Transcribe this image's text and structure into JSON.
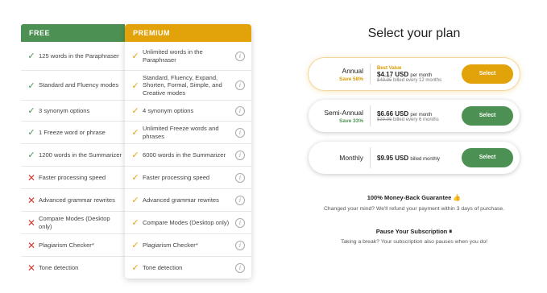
{
  "table": {
    "free_header": "FREE",
    "premium_header": "PREMIUM",
    "rows": [
      {
        "free": "125 words in the Paraphraser",
        "free_ok": true,
        "premium": "Unlimited words in the Paraphraser"
      },
      {
        "free": "Standard and Fluency modes",
        "free_ok": true,
        "premium": "Standard, Fluency, Expand, Shorten, Formal, Simple, and Creative modes"
      },
      {
        "free": "3 synonym options",
        "free_ok": true,
        "premium": "4 synonym options"
      },
      {
        "free": "1 Freeze word or phrase",
        "free_ok": true,
        "premium": "Unlimited Freeze words and phrases"
      },
      {
        "free": "1200 words in the Summarizer",
        "free_ok": true,
        "premium": "6000 words in the Summarizer"
      },
      {
        "free": "Faster processing speed",
        "free_ok": false,
        "premium": "Faster processing speed"
      },
      {
        "free": "Advanced grammar rewrites",
        "free_ok": false,
        "premium": "Advanced grammar rewrites"
      },
      {
        "free": "Compare Modes (Desktop only)",
        "free_ok": false,
        "premium": "Compare Modes (Desktop only)"
      },
      {
        "free": "Plagiarism Checker*",
        "free_ok": false,
        "premium": "Plagiarism Checker*"
      },
      {
        "free": "Tone detection",
        "free_ok": false,
        "premium": "Tone detection"
      }
    ]
  },
  "plans": {
    "title": "Select your plan",
    "items": [
      {
        "name": "Annual",
        "save": "Save 58%",
        "badge": "Best Value",
        "price": "$4.17 USD",
        "per": "per month",
        "old": "$49.95",
        "billed": "billed every 12 months",
        "button": "Select",
        "color": "#e1a20a"
      },
      {
        "name": "Semi-Annual",
        "save": "Save 33%",
        "badge": "",
        "price": "$6.66 USD",
        "per": "per month",
        "old": "$39.95",
        "billed": "billed every 6 months",
        "button": "Select",
        "color": "#4c9153"
      },
      {
        "name": "Monthly",
        "save": "",
        "badge": "",
        "price": "$9.95 USD",
        "per": "billed monthly",
        "old": "",
        "billed": "",
        "button": "Select",
        "color": "#4c9153"
      }
    ]
  },
  "guarantee": {
    "title": "100% Money-Back Guarantee",
    "text": "Changed your mind? We'll refund your payment within 3 days of purchase."
  },
  "pause": {
    "title": "Pause Your Subscription",
    "text": "Taking a break? Your subscription also pauses when you do!"
  },
  "icons": {
    "check": "check-icon",
    "cross": "cross-icon",
    "info": "info-icon",
    "thumbs_up": "thumbs-up-icon",
    "pause": "pause-icon"
  }
}
